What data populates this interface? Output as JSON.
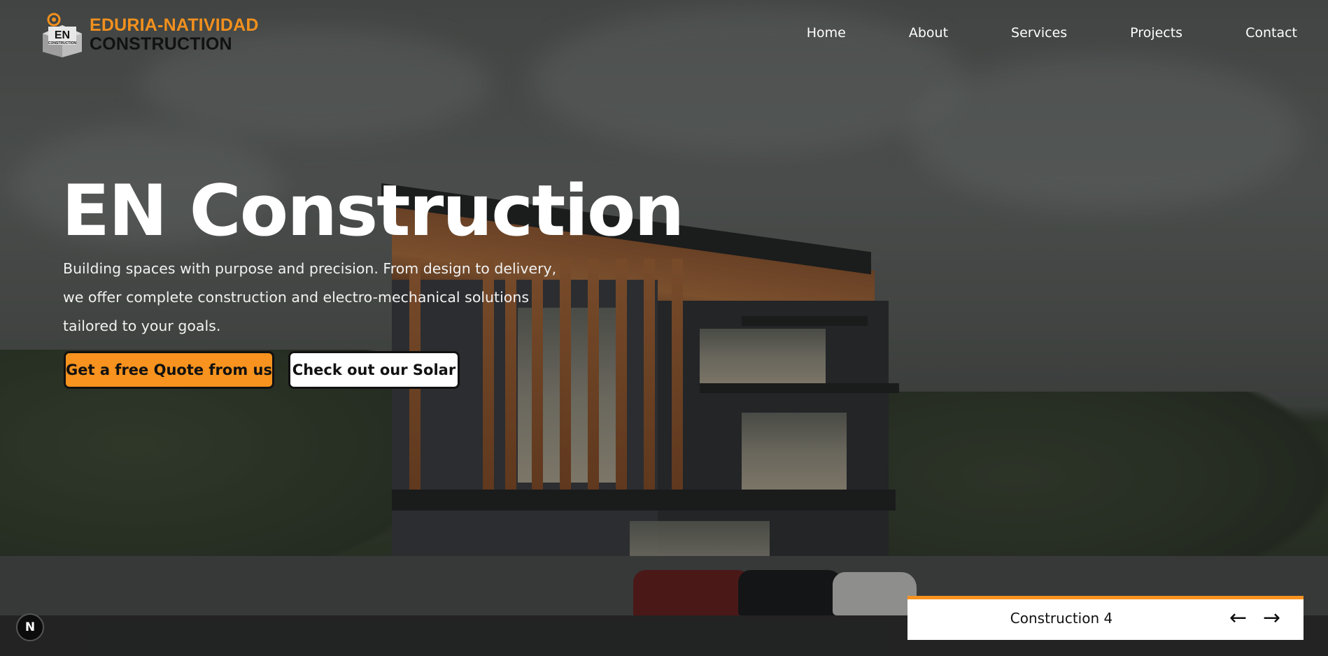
{
  "header": {
    "logo_mark_text": "EN",
    "logo_mark_subtext": "CONSTRUCTION",
    "logo_line1": "EDURIA-NATIVIDAD",
    "logo_line2": "CONSTRUCTION"
  },
  "nav": {
    "items": [
      {
        "label": "Home"
      },
      {
        "label": "About"
      },
      {
        "label": "Services"
      },
      {
        "label": "Projects"
      },
      {
        "label": "Contact"
      }
    ]
  },
  "hero": {
    "title": "EN Construction",
    "description": "Building spaces with purpose and precision. From design to delivery, we offer complete construction and electro-mechanical solutions tailored to your goals.",
    "primary_button": "Get a free Quote from us",
    "secondary_button": "Check out our Solar"
  },
  "slider": {
    "label": "Construction 4",
    "prev_icon": "←",
    "next_icon": "→"
  },
  "badge": {
    "letter": "N"
  },
  "colors": {
    "accent": "#f7931e",
    "text_light": "#ffffff",
    "text_dark": "#111111"
  }
}
